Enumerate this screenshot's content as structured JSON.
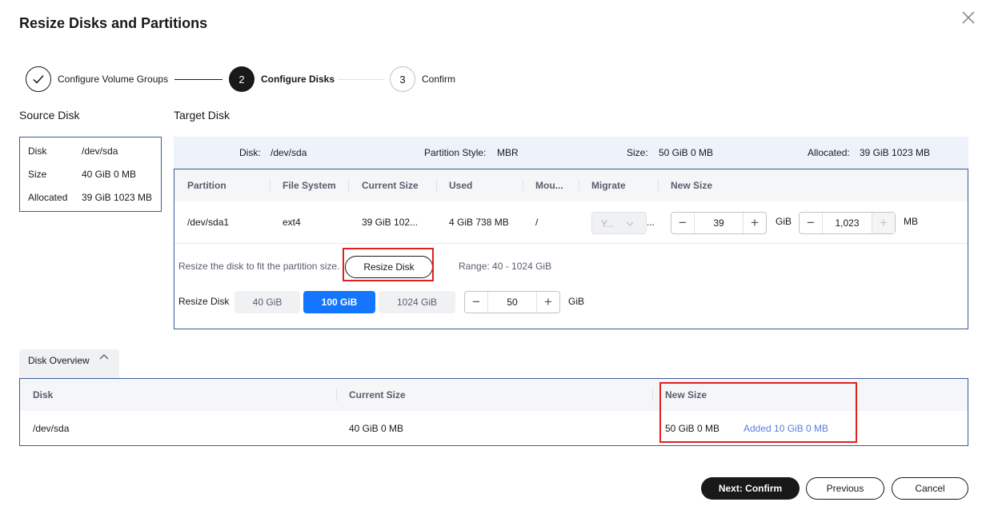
{
  "dialog": {
    "title": "Resize Disks and Partitions"
  },
  "steps": [
    {
      "label": "Configure Volume Groups",
      "state": "done"
    },
    {
      "number": "2",
      "label": "Configure Disks",
      "state": "active"
    },
    {
      "number": "3",
      "label": "Confirm",
      "state": "todo"
    }
  ],
  "source": {
    "title": "Source Disk",
    "rows": [
      {
        "key": "Disk",
        "value": "/dev/sda"
      },
      {
        "key": "Size",
        "value": "40 GiB 0 MB"
      },
      {
        "key": "Allocated",
        "value": "39 GiB 1023 MB"
      }
    ]
  },
  "target": {
    "title": "Target Disk",
    "strip": {
      "disk_label": "Disk:",
      "disk_value": "/dev/sda",
      "style_label": "Partition Style:",
      "style_value": "MBR",
      "size_label": "Size:",
      "size_value": "50 GiB 0 MB",
      "alloc_label": "Allocated:",
      "alloc_value": "39 GiB 1023 MB"
    },
    "columns": [
      "Partition",
      "File System",
      "Current Size",
      "Used",
      "Mou...",
      "Migrate",
      "New Size"
    ],
    "row": {
      "partition": "/dev/sda1",
      "fs": "ext4",
      "current": "39 GiB 102...",
      "used": "4 GiB 738 MB",
      "mount": "/",
      "migrate": "Y...",
      "migrate_ellipsis": "...",
      "new_gib": "39",
      "gib_unit": "GiB",
      "new_mb": "1,023",
      "mb_unit": "MB"
    },
    "hint": "Resize the disk to fit the partition size.",
    "resize_button": "Resize Disk",
    "range": "Range: 40  -  1024  GiB",
    "resize_label": "Resize Disk",
    "options": [
      "40 GiB",
      "100 GiB",
      "1024 GiB"
    ],
    "selected_option": "100 GiB",
    "resize_value": "50",
    "resize_unit": "GiB"
  },
  "overview": {
    "tab_label": "Disk Overview",
    "columns": [
      "Disk",
      "Current Size",
      "New Size"
    ],
    "row": {
      "disk": "/dev/sda",
      "current": "40 GiB 0 MB",
      "new": "50 GiB 0 MB",
      "added": "Added 10 GiB 0 MB"
    }
  },
  "footer": {
    "next": "Next: Confirm",
    "previous": "Previous",
    "cancel": "Cancel"
  },
  "colors": {
    "accent": "#1476ff",
    "highlight": "#e02020",
    "link": "#5e7ce0",
    "border": "#3c5a99"
  }
}
